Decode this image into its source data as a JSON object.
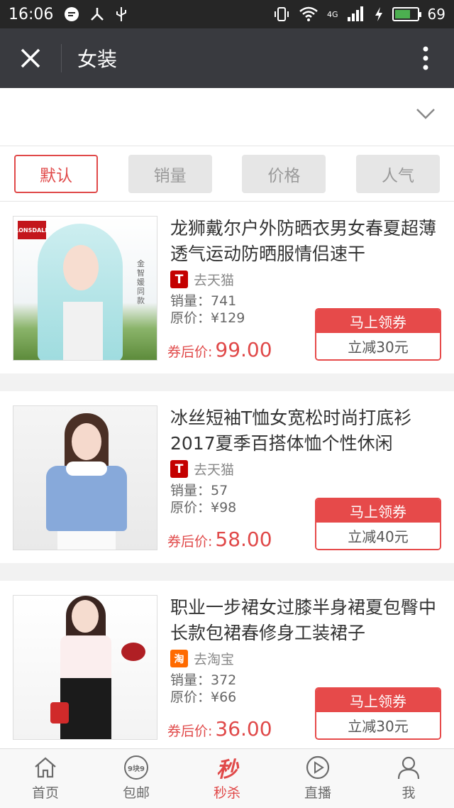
{
  "status_bar": {
    "time": "16:06",
    "network": "4G",
    "battery": "69"
  },
  "title_bar": {
    "title": "女装"
  },
  "sort": {
    "options": [
      "默认",
      "销量",
      "价格",
      "人气"
    ],
    "active": "默认"
  },
  "products": [
    {
      "name": "龙狮戴尔户外防晒衣男女春夏超薄透气运动防晒服情侣速干",
      "shop_logo": "T",
      "shop_label": "去天猫",
      "sales": "销量：741",
      "original_price": "原价：¥129",
      "after_label": "券后价:",
      "after_price": "99.00",
      "coupon_title": "马上领券",
      "coupon_desc": "立减30元"
    },
    {
      "name": "冰丝短袖T恤女宽松时尚打底衫2017夏季百搭体恤个性休闲",
      "shop_logo": "T",
      "shop_label": "去天猫",
      "sales": "销量：57",
      "original_price": "原价：¥98",
      "after_label": "券后价:",
      "after_price": "58.00",
      "coupon_title": "马上领券",
      "coupon_desc": "立减40元"
    },
    {
      "name": "职业一步裙女过膝半身裙夏包臀中长款包裙春修身工装裙子",
      "shop_logo": "淘",
      "shop_label": "去淘宝",
      "sales": "销量：372",
      "original_price": "原价：¥66",
      "after_label": "券后价:",
      "after_price": "36.00",
      "coupon_title": "马上领券",
      "coupon_desc": "立减30元"
    }
  ],
  "image_text": {
    "brand_logo": "LONSDALE",
    "caption": "金智媛同款"
  },
  "bottom_nav": [
    {
      "label": "首页",
      "icon": "home-icon"
    },
    {
      "label": "包邮",
      "icon": "nine-nine-icon",
      "icon_text": "9块9"
    },
    {
      "label": "秒杀",
      "icon": "flash-sale-icon",
      "icon_text": "秒"
    },
    {
      "label": "直播",
      "icon": "play-icon"
    },
    {
      "label": "我",
      "icon": "user-icon"
    }
  ],
  "colors": {
    "accent": "#e04949",
    "titlebar": "#393a3f",
    "statusbar": "#262626"
  }
}
